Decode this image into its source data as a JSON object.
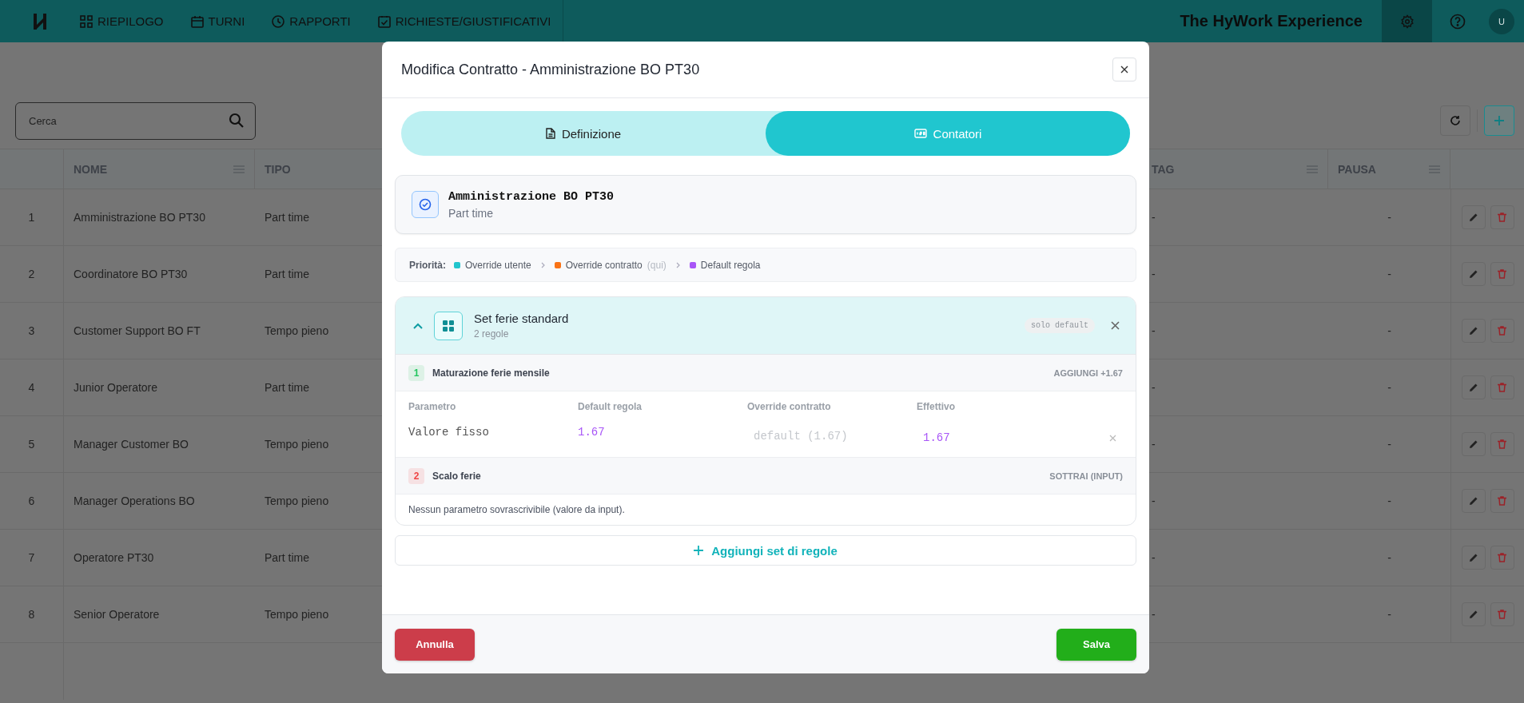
{
  "nav": {
    "items": [
      {
        "label": "RIEPILOGO"
      },
      {
        "label": "TURNI"
      },
      {
        "label": "RAPPORTI"
      },
      {
        "label": "RICHIESTE/GIUSTIFICATIVI"
      }
    ],
    "brand": "The HyWork Experience",
    "settings": {
      "selected": true
    },
    "avatar": "U"
  },
  "search": {
    "placeholder": "Cerca"
  },
  "table": {
    "columns": [
      "NOME",
      "TIPO",
      "TAG",
      "PAUSA"
    ],
    "rows": [
      {
        "index": "1",
        "nome": "Amministrazione BO PT30",
        "tipo": "Part time",
        "tag": "-",
        "pausa": "-"
      },
      {
        "index": "2",
        "nome": "Coordinatore BO PT30",
        "tipo": "Part time",
        "tag": "-",
        "pausa": "-"
      },
      {
        "index": "3",
        "nome": "Customer Support BO FT",
        "tipo": "Tempo pieno",
        "tag": "-",
        "pausa": "-"
      },
      {
        "index": "4",
        "nome": "Junior Operatore",
        "tipo": "Part time",
        "tag": "-",
        "pausa": "-"
      },
      {
        "index": "5",
        "nome": "Manager Customer BO",
        "tipo": "Tempo pieno",
        "tag": "-",
        "pausa": "-"
      },
      {
        "index": "6",
        "nome": "Manager Operations BO",
        "tipo": "Tempo pieno",
        "tag": "-",
        "pausa": "-"
      },
      {
        "index": "7",
        "nome": "Operatore PT30",
        "tipo": "Part time",
        "tag": "-",
        "pausa": "-"
      },
      {
        "index": "8",
        "nome": "Senior Operatore",
        "tipo": "Tempo pieno",
        "tag": "-",
        "pausa": "-"
      }
    ]
  },
  "modal": {
    "title": "Modifica Contratto - Amministrazione BO PT30",
    "tabs": [
      {
        "label": "Definizione",
        "selected": false
      },
      {
        "label": "Contatori",
        "selected": true
      }
    ],
    "contract": {
      "name": "Amministrazione BO PT30",
      "type": "Part time"
    },
    "priority": {
      "label": "Priorità:",
      "items": [
        {
          "label": "Override utente",
          "color": "#22c5cd"
        },
        {
          "label": "Override contratto",
          "note": "(qui)",
          "color": "#f97316"
        },
        {
          "label": "Default regola",
          "color": "#a855f7"
        }
      ]
    },
    "rule_set": {
      "title": "Set ferie standard",
      "count": "2 regole",
      "badge": "solo default",
      "expanded": true,
      "rules": [
        {
          "kind": "params",
          "number": "1",
          "name": "Maturazione ferie mensile",
          "action": "AGGIUNGI +1.67",
          "color": "#22c55e",
          "columns": [
            "Parametro",
            "Default regola",
            "Override contratto",
            "Effettivo"
          ],
          "params": [
            {
              "name": "Valore fisso",
              "default": "1.67",
              "placeholder": "default (1.67)",
              "effective": "1.67"
            }
          ]
        },
        {
          "kind": "note",
          "number": "2",
          "name": "Scalo ferie",
          "action": "SOTTRAI (INPUT)",
          "color": "#ef4444",
          "note": "Nessun parametro sovrascrivibile (valore da input)."
        }
      ]
    },
    "add_button": "Aggiungi set di regole",
    "buttons": {
      "cancel": "Annulla",
      "save": "Salva"
    }
  }
}
